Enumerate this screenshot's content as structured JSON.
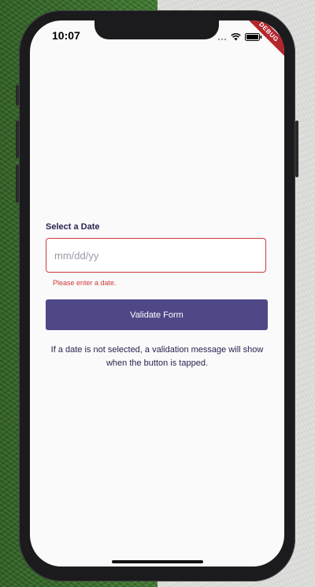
{
  "status_bar": {
    "time": "10:07",
    "icons": [
      "dots-icon",
      "wifi-icon",
      "battery-icon"
    ]
  },
  "debug_banner": "DEBUG",
  "form": {
    "label": "Select a Date",
    "date_input": {
      "value": "",
      "placeholder": "mm/dd/yy"
    },
    "error_message": "Please enter a date.",
    "submit_label": "Validate Form",
    "help_text": "If a date is not selected, a validation message will show when the button is tapped."
  },
  "colors": {
    "accent": "#4e4887",
    "error": "#cf3b3b",
    "text_dark": "#2a2350"
  }
}
